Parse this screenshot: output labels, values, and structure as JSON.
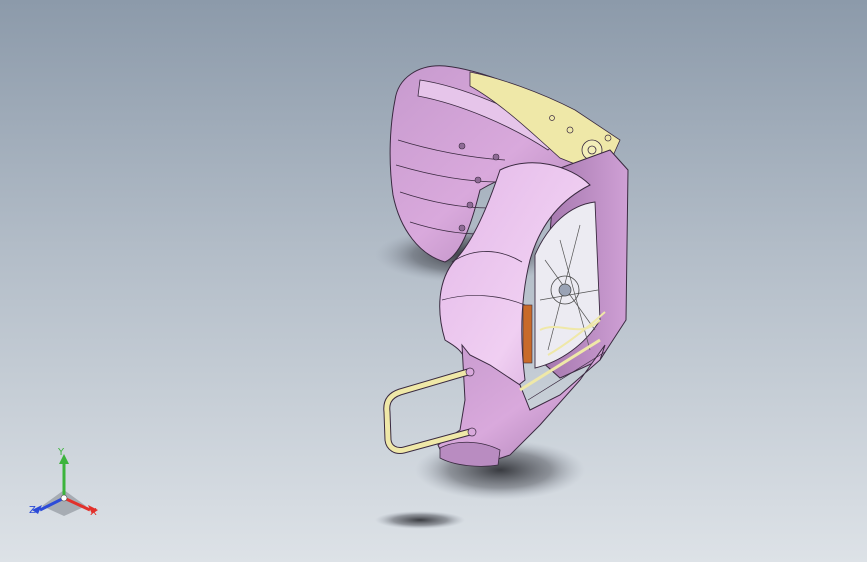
{
  "viewport": {
    "background_top": "#8c9aaa",
    "background_bottom": "#dde2e7"
  },
  "model": {
    "body_color": "#d9a9dc",
    "body_highlight": "#eccdf0",
    "body_shadow": "#9a6fa4",
    "edge_color": "#3a2a40",
    "trim_color": "#efe8a8",
    "accent_color": "#c86a2a"
  },
  "triad": {
    "x_label": "X",
    "y_label": "Y",
    "z_label": "Z",
    "x_color": "#e2312b",
    "y_color": "#3cb43c",
    "z_color": "#2b4bd8"
  }
}
